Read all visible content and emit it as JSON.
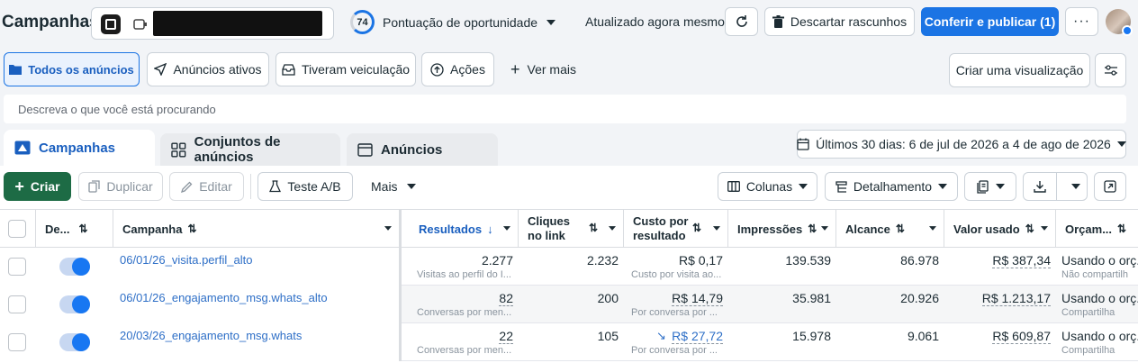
{
  "header": {
    "title": "Campanhas",
    "score": "74",
    "score_label": "Pontuação de oportunidade",
    "updated": "Atualizado agora mesmo",
    "discard": "Descartar rascunhos",
    "publish": "Conferir e publicar (1)"
  },
  "filters": {
    "all_ads": "Todos os anúncios",
    "active_ads": "Anúncios ativos",
    "had_delivery": "Tiveram veiculação",
    "actions": "Ações",
    "see_more": "Ver mais",
    "create_view": "Criar uma visualização"
  },
  "search": {
    "placeholder": "Descreva o que você está procurando"
  },
  "tabs": {
    "campaigns": "Campanhas",
    "adsets": "Conjuntos de anúncios",
    "ads": "Anúncios"
  },
  "date_range": "Últimos 30 dias: 6 de jul de 2026 a 4 de ago de 2026",
  "toolbar": {
    "create": "Criar",
    "duplicate": "Duplicar",
    "edit": "Editar",
    "ab_test": "Teste A/B",
    "more": "Mais",
    "columns": "Colunas",
    "breakdown": "Detalhamento"
  },
  "columns": {
    "delivery": "De...",
    "campaign": "Campanha",
    "results": "Resultados",
    "link_clicks": "Cliques no link",
    "cost_per_result": "Custo por resultado",
    "impressions": "Impressões",
    "reach": "Alcance",
    "amount_spent": "Valor usado",
    "budget": "Orçam..."
  },
  "rows": [
    {
      "name": "06/01/26_visita.perfil_alto",
      "results": "2.277",
      "results_sub": "Visitas ao perfil do I...",
      "clicks": "2.232",
      "cost": "R$ 0,17",
      "cost_sub": "Custo por visita ao...",
      "impressions": "139.539",
      "reach": "86.978",
      "spent": "R$ 387,34",
      "budget": "Usando o orç...",
      "budget_sub": "Não compartilh"
    },
    {
      "name": "06/01/26_engajamento_msg.whats_alto",
      "results": "82",
      "results_sub": "Conversas por men...",
      "clicks": "200",
      "cost": "R$ 14,79",
      "cost_sub": "Por conversa por ...",
      "impressions": "35.981",
      "reach": "20.926",
      "spent": "R$ 1.213,17",
      "budget": "Usando o orç...",
      "budget_sub": "Compartilha"
    },
    {
      "name": "20/03/26_engajamento_msg.whats",
      "results": "22",
      "results_sub": "Conversas por men...",
      "clicks": "105",
      "cost": "R$ 27,72",
      "cost_sub": "Por conversa por ...",
      "impressions": "15.978",
      "reach": "9.061",
      "spent": "R$ 609,87",
      "budget": "Usando o orç...",
      "budget_sub": "Compartilha"
    }
  ],
  "colors": {
    "primary": "#1b74e4",
    "create_green": "#1d6b45",
    "link": "#2e6fc7"
  }
}
